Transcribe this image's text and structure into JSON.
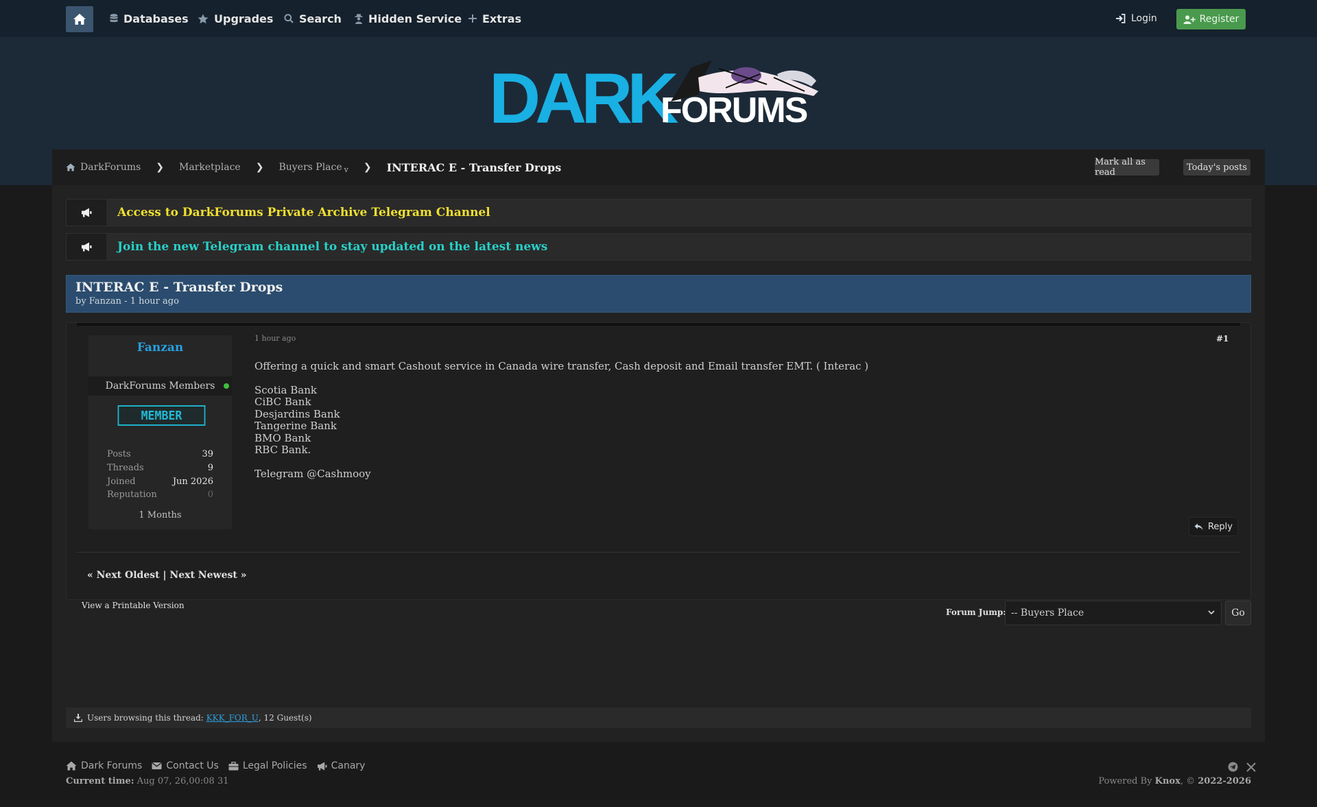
{
  "nav": {
    "items": [
      {
        "label": "Databases",
        "icon": "database-icon"
      },
      {
        "label": "Upgrades",
        "icon": "star-icon"
      },
      {
        "label": "Search",
        "icon": "search-icon"
      },
      {
        "label": "Hidden Service",
        "icon": "spy-icon"
      },
      {
        "label": "Extras",
        "icon": "plus-icon"
      }
    ],
    "login": "Login",
    "register": "Register"
  },
  "logo": {
    "word1": "DARK",
    "word2": "FORUMS"
  },
  "breadcrumb": {
    "items": [
      "DarkForums",
      "Marketplace",
      "Buyers Place"
    ],
    "dropdown_marker": "v",
    "current": "INTERAC E - Transfer Drops",
    "mark_all_read": "Mark all as read",
    "todays_posts": "Today's posts"
  },
  "announcements": [
    {
      "text": "Access to DarkForums Private Archive Telegram Channel",
      "color": "#f0e030"
    },
    {
      "text": "Join the new Telegram channel to stay updated on the latest news",
      "color": "#28d0c8"
    }
  ],
  "thread": {
    "title": "INTERAC E - Transfer Drops",
    "meta": "by Fanzan - 1 hour ago"
  },
  "post": {
    "author": {
      "name": "Fanzan",
      "group": "DarkForums Members",
      "rank": "MEMBER",
      "stats": [
        {
          "label": "Posts",
          "value": "39"
        },
        {
          "label": "Threads",
          "value": "9"
        },
        {
          "label": "Joined",
          "value": "Jun 2026"
        },
        {
          "label": "Reputation",
          "value": "0"
        }
      ],
      "tenure": "1 Months"
    },
    "date": "1 hour ago",
    "number": "#1",
    "body": {
      "intro": "Offering a quick and smart Cashout service in Canada wire transfer, Cash deposit and Email transfer EMT. ( Interac )",
      "banks": [
        "Scotia Bank",
        "CiBC Bank",
        "Desjardins Bank",
        "Tangerine Bank",
        "BMO Bank",
        "RBC Bank."
      ],
      "contact": "Telegram @Cashmooy"
    },
    "reply": "Reply"
  },
  "pager": "« Next Oldest | Next Newest »",
  "printable": "View a Printable Version",
  "forum_jump": {
    "label": "Forum Jump:",
    "selected": "-- Buyers Place",
    "go": "Go"
  },
  "browsing": {
    "prefix": "Users browsing this thread:",
    "user": "KKK_FOR_U",
    "suffix": ", 12 Guest(s)"
  },
  "footer": {
    "links": [
      {
        "label": "Dark Forums",
        "icon": "home-icon"
      },
      {
        "label": "Contact Us",
        "icon": "envelope-icon"
      },
      {
        "label": "Legal Policies",
        "icon": "briefcase-icon"
      },
      {
        "label": "Canary",
        "icon": "bullhorn-icon"
      }
    ],
    "current_time_label": "Current time:",
    "current_time": "Aug 07, 26,00:08 31",
    "powered_prefix": "Powered By",
    "powered_brand": "Knox",
    "copyright_prefix": ", ©",
    "copyright_years": "2022-2026"
  },
  "colors": {
    "accent_blue": "#2a9fe0",
    "register_green": "#4a9a4e",
    "thread_header": "#2b4c6e",
    "logo_cyan": "#19b0e3"
  }
}
